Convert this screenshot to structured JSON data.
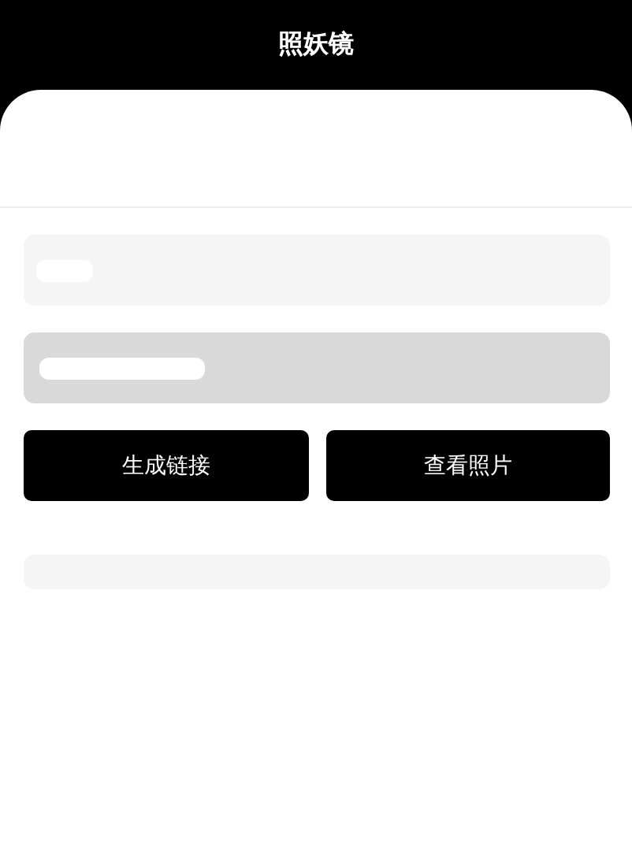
{
  "header": {
    "title": "照妖镜"
  },
  "fields": [
    {
      "disabled": false
    },
    {
      "disabled": true
    }
  ],
  "buttons": [
    "生成链接",
    "查看照片"
  ]
}
